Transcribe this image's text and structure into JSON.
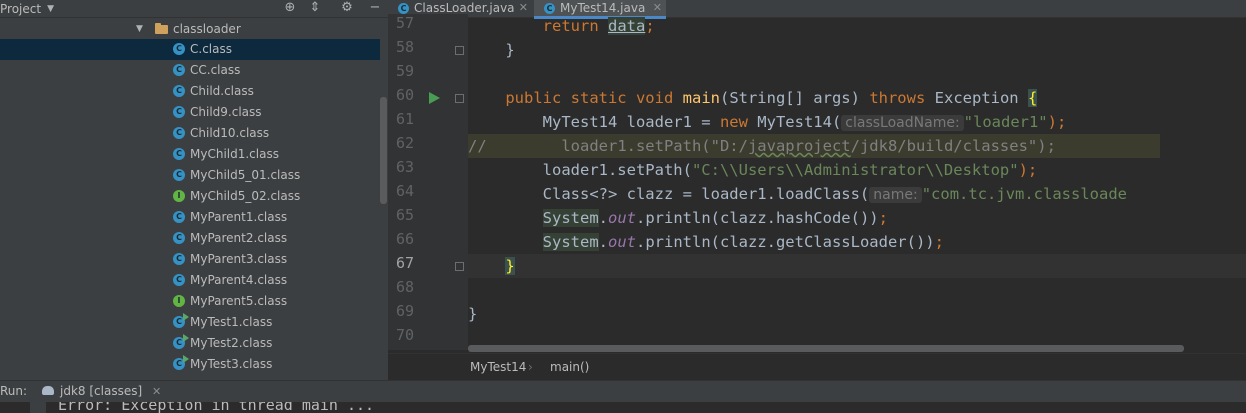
{
  "project_panel": {
    "title": "Project",
    "icons": [
      "chevron-down-icon",
      "crosshair-icon",
      "collapse-icon",
      "gear-icon",
      "minimize-icon"
    ],
    "folder": "classloader",
    "items": [
      {
        "label": "C.class",
        "kind": "class",
        "selected": true
      },
      {
        "label": "CC.class",
        "kind": "class"
      },
      {
        "label": "Child.class",
        "kind": "class"
      },
      {
        "label": "Child9.class",
        "kind": "class"
      },
      {
        "label": "Child10.class",
        "kind": "class"
      },
      {
        "label": "MyChild1.class",
        "kind": "class"
      },
      {
        "label": "MyChild5_01.class",
        "kind": "class"
      },
      {
        "label": "MyChild5_02.class",
        "kind": "interface"
      },
      {
        "label": "MyParent1.class",
        "kind": "class"
      },
      {
        "label": "MyParent2.class",
        "kind": "class"
      },
      {
        "label": "MyParent3.class",
        "kind": "class"
      },
      {
        "label": "MyParent4.class",
        "kind": "class"
      },
      {
        "label": "MyParent5.class",
        "kind": "interface"
      },
      {
        "label": "MyTest1.class",
        "kind": "runnable"
      },
      {
        "label": "MyTest2.class",
        "kind": "runnable"
      },
      {
        "label": "MyTest3.class",
        "kind": "runnable"
      }
    ]
  },
  "editor": {
    "tabs": [
      {
        "label": "ClassLoader.java",
        "active": false
      },
      {
        "label": "MyTest14.java",
        "active": true
      }
    ],
    "line_numbers": [
      "57",
      "58",
      "59",
      "60",
      "61",
      "62",
      "63",
      "64",
      "65",
      "66",
      "67",
      "68",
      "69",
      "70"
    ],
    "current_line": "67",
    "code": {
      "l57_kw": "return",
      "l57_id": "data",
      "l57_end": ";",
      "l58": "}",
      "l60_mods": "public static void",
      "l60_name": "main",
      "l60_sig": "(String[] args)",
      "l60_throws": "throws",
      "l60_exc": "Exception",
      "l60_brace": "{",
      "l61_a": "MyTest14 loader1 = ",
      "l61_new": "new",
      "l61_b": " MyTest14(",
      "l61_hint": "classLoadName:",
      "l61_str": "\"loader1\"",
      "l61_end": ");",
      "l62_slashes": "//",
      "l62_a": "        loader1.setPath(",
      "l62_str_a": "\"D:/",
      "l62_str_b": "javaproject",
      "l62_str_c": "/jdk8/build/classes\"",
      "l62_end": ");",
      "l63_a": "loader1.setPath(",
      "l63_str": "\"C:\\\\Users\\\\Administrator\\\\Desktop\"",
      "l63_end": ");",
      "l64_a": "Class<?> clazz = loader1.loadClass(",
      "l64_hint": "name:",
      "l64_str": "\"com.tc.jvm.classloade",
      "l65_sys": "System",
      "l65_dot": ".",
      "l65_out": "out",
      "l65_rest": ".println(clazz.hashCode())",
      "l65_end": ";",
      "l66_sys": "System",
      "l66_dot": ".",
      "l66_out": "out",
      "l66_rest": ".println(clazz.getClassLoader())",
      "l66_end": ";",
      "l67": "}",
      "l69": "}"
    },
    "breadcrumb": [
      "MyTest14",
      "main()"
    ]
  },
  "run_bar": {
    "label": "Run:",
    "tab": "jdk8 [classes]",
    "console_text": "Error: Exception in thread main ..."
  },
  "colors": {
    "keyword": "#cc7832",
    "string": "#6a8759",
    "method_decl": "#ffc66d",
    "static_field": "#9876aa",
    "selection": "#0d293e",
    "class_icon": "#3592c4",
    "interface_icon": "#62b543"
  }
}
